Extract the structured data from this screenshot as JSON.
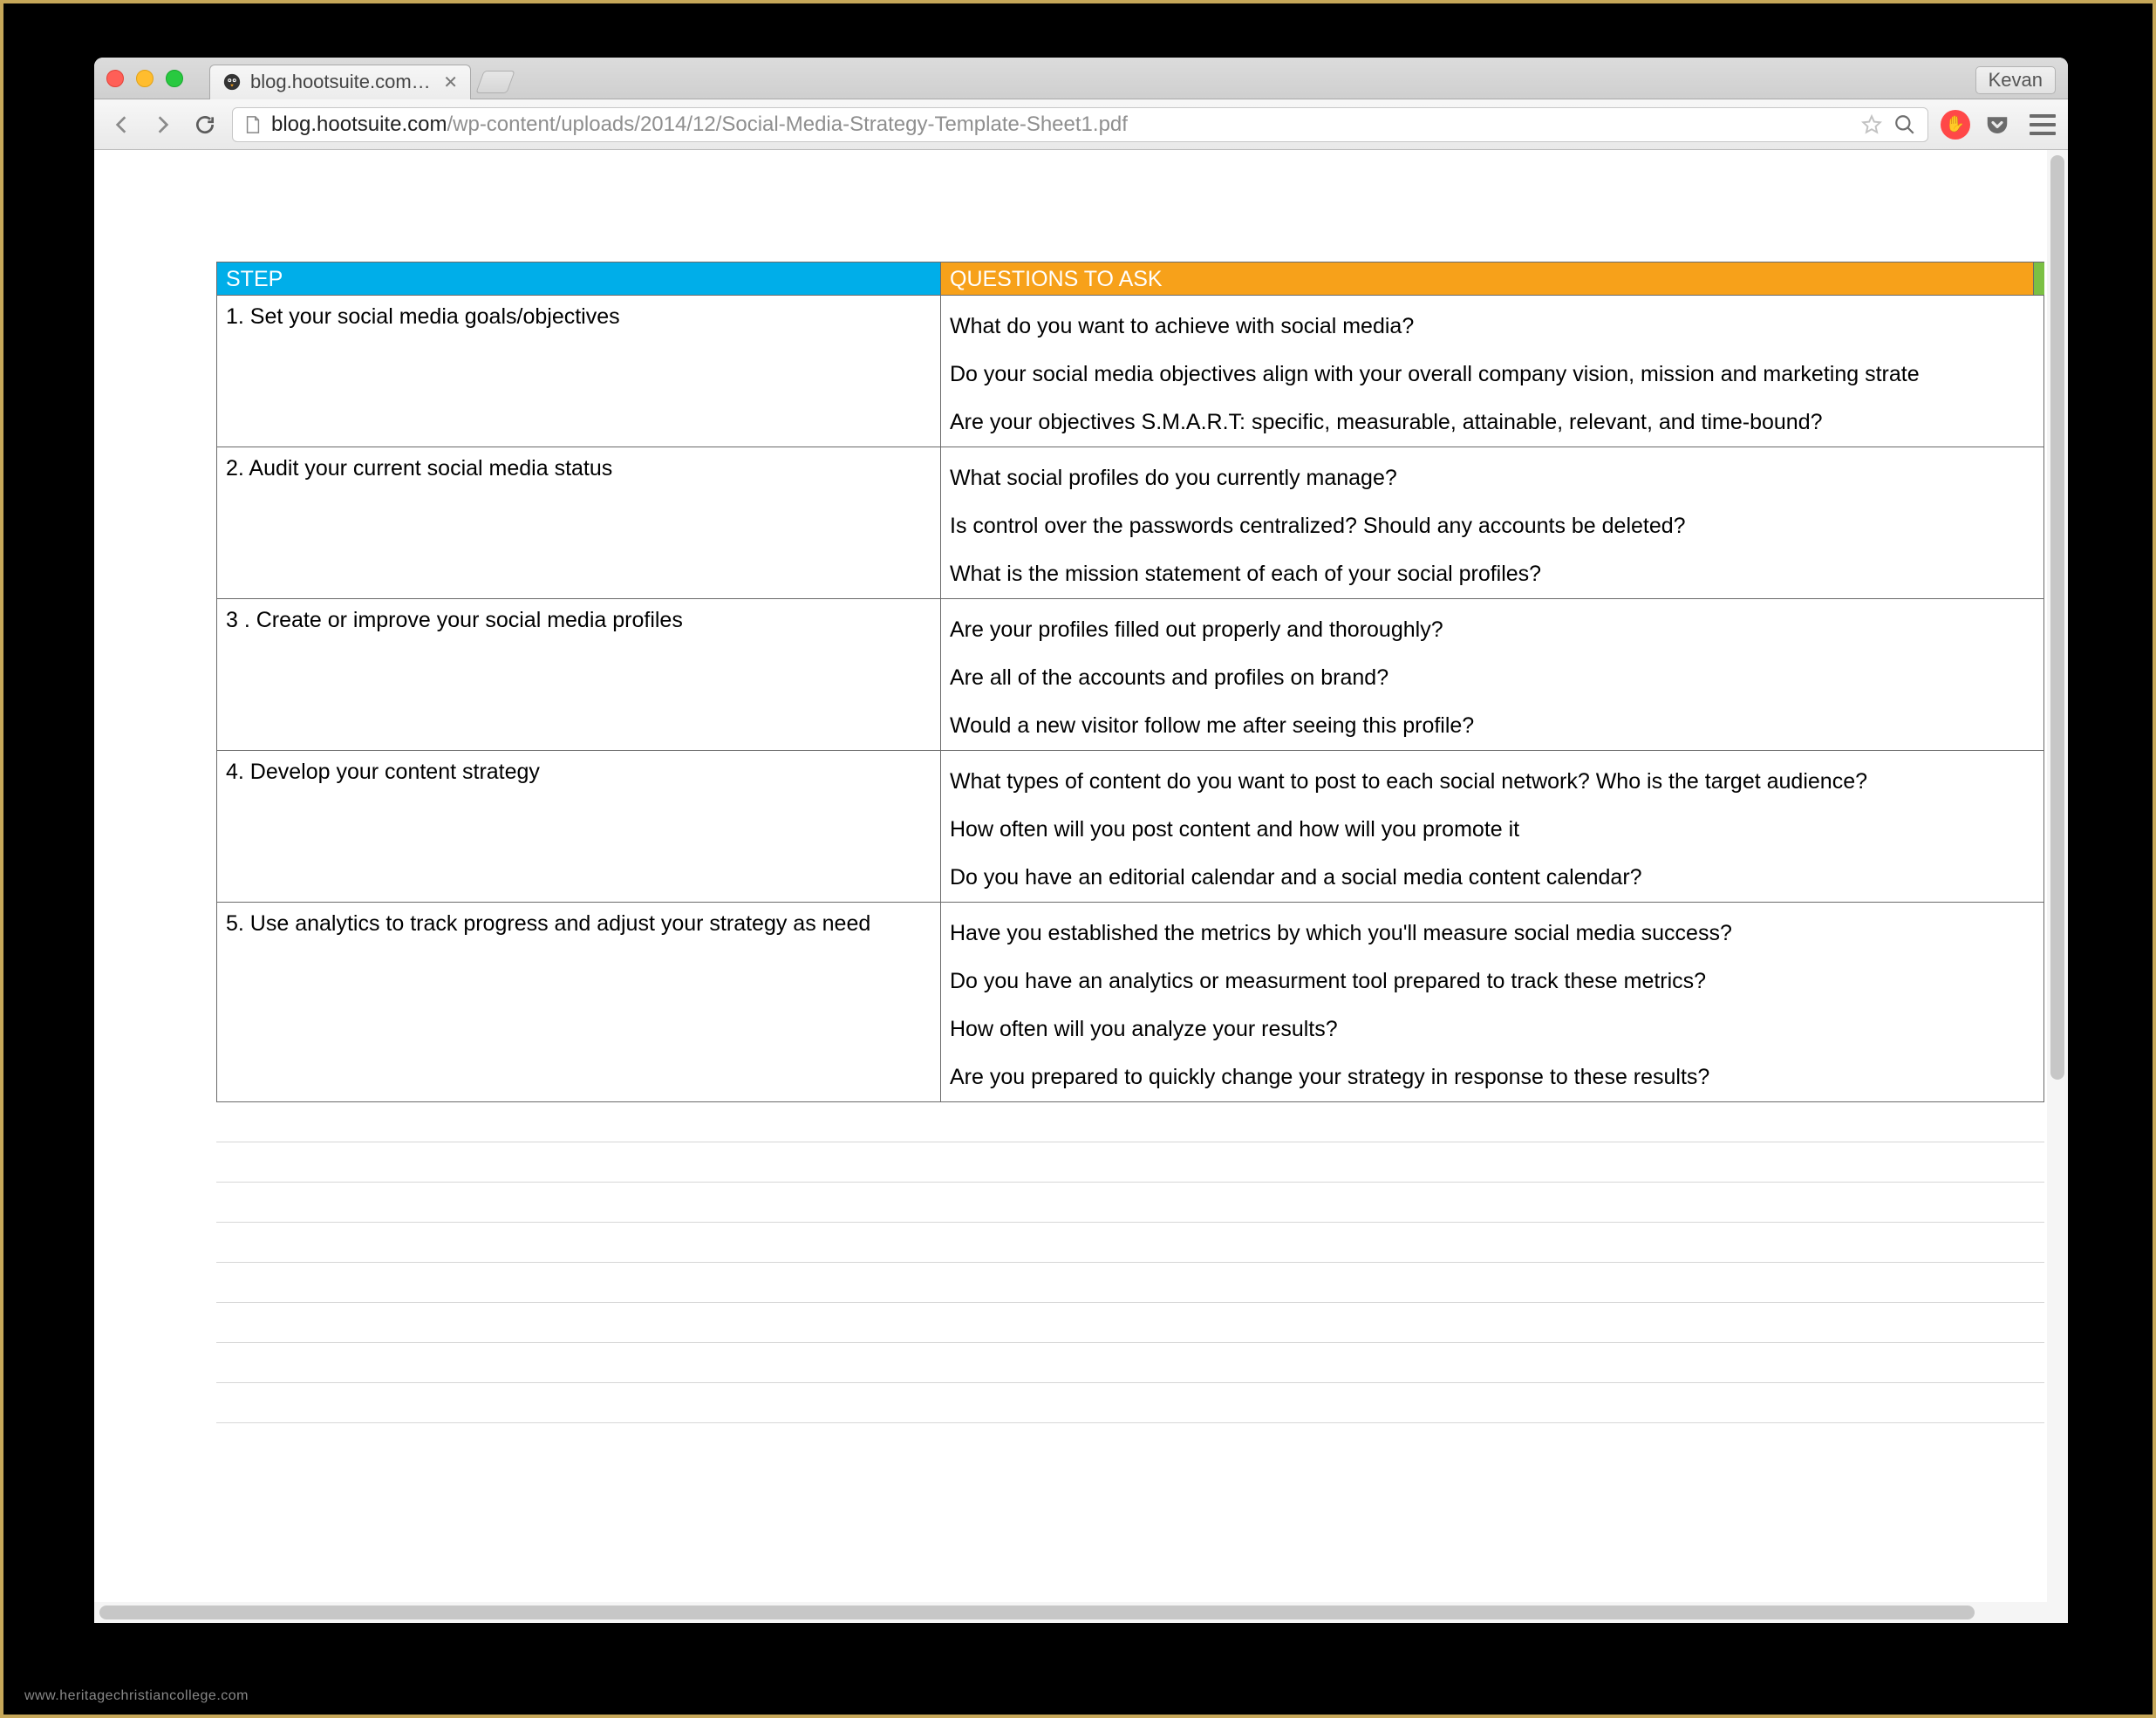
{
  "watermark": "www.heritagechristiancollege.com",
  "browser": {
    "profile_name": "Kevan",
    "tab_title": "blog.hootsuite.com/wp-con",
    "url_domain": "blog.hootsuite.com",
    "url_path": "/wp-content/uploads/2014/12/Social-Media-Strategy-Template-Sheet1.pdf"
  },
  "table": {
    "header_step": "STEP",
    "header_questions": "QUESTIONS TO ASK",
    "rows": [
      {
        "step": "1. Set your social media goals/objectives",
        "questions": [
          "What do you want to achieve with social media?",
          "Do your social media objectives align with your overall company vision, mission and marketing strate",
          "Are your objectives S.M.A.R.T: specific, measurable, attainable, relevant, and time-bound?"
        ]
      },
      {
        "step": "2. Audit your current social media status",
        "questions": [
          "What social profiles do you currently manage?",
          "Is control over the passwords centralized? Should any accounts be deleted?",
          "What is the mission statement of each of your social profiles?"
        ]
      },
      {
        "step": "3 . Create or improve your social media profiles",
        "questions": [
          "Are your profiles filled out properly and thoroughly?",
          "Are all of the accounts and profiles on brand?",
          "Would a new visitor follow me after seeing this profile?"
        ]
      },
      {
        "step": "4. Develop your content strategy",
        "questions": [
          "What types of content do you want to post to each social network? Who is the target audience?",
          "How often will you post content and how will you promote it",
          "Do you have an editorial calendar and a social media content calendar?"
        ]
      },
      {
        "step": "5. Use analytics to track progress and adjust your strategy as need",
        "questions": [
          "Have you established the metrics by which you'll measure social media success?",
          "Do you have an analytics or measurment tool prepared to track these metrics?",
          "How often will you analyze your results?",
          "Are you prepared to quickly change your strategy in response to these results?"
        ]
      }
    ]
  },
  "ext_ublock_label": "✋"
}
